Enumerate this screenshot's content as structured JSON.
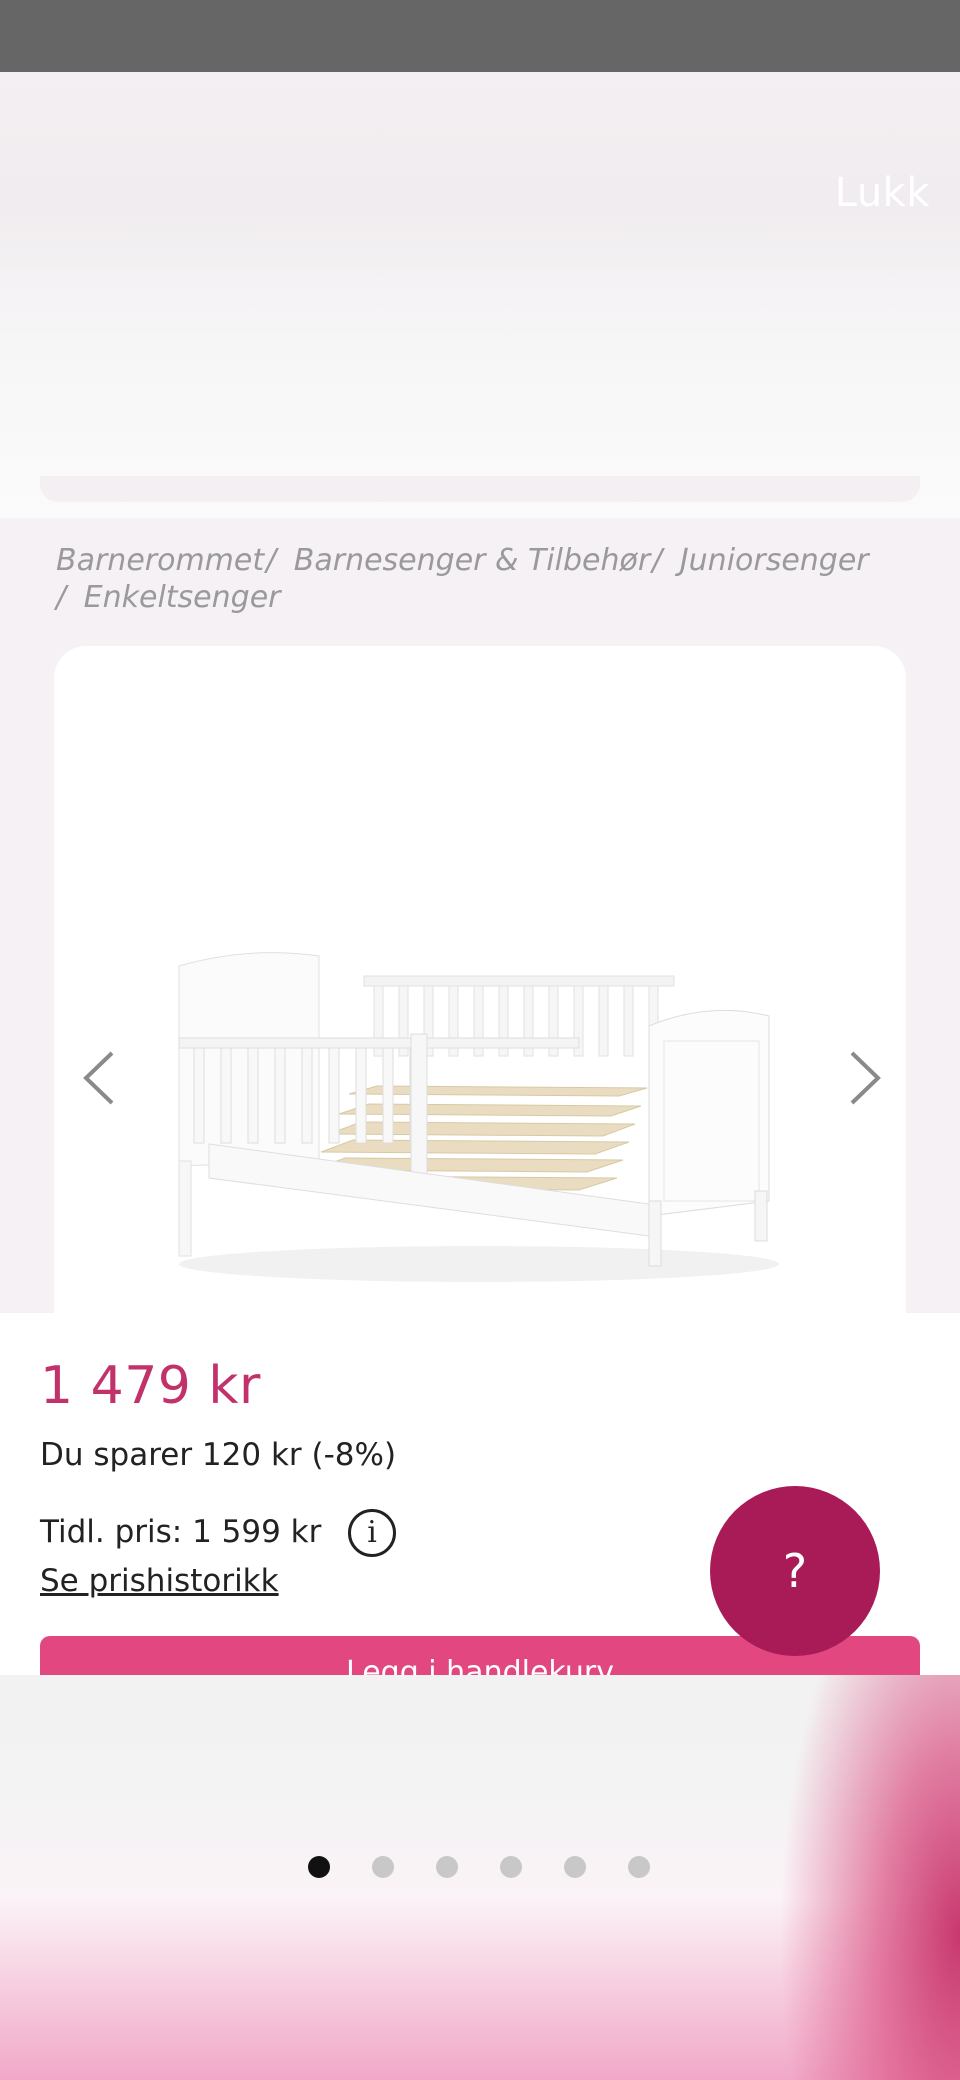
{
  "overlay": {
    "close_label": "Lukk"
  },
  "breadcrumb": {
    "items": [
      "Barnerommet",
      "Barnesenger & Tilbehør",
      "Juniorsenger",
      "Enkeltsenger"
    ],
    "separator": "/"
  },
  "product": {
    "price": "1 479 kr",
    "savings": "Du sparer 120 kr (-8%)",
    "previous_price": "Tidl. pris: 1 599 kr",
    "info_icon_glyph": "i",
    "price_history_link": "Se prishistorikk",
    "add_to_cart_label": "Legg i handlekurv",
    "image_icon": "toddler-bed-image"
  },
  "help": {
    "label": "?"
  },
  "carousel": {
    "total": 6,
    "active_index": 0
  },
  "colors": {
    "price": "#c2326a",
    "help_button": "#a91b57",
    "cart_button": "#e2477f",
    "status_bar": "#666666"
  }
}
